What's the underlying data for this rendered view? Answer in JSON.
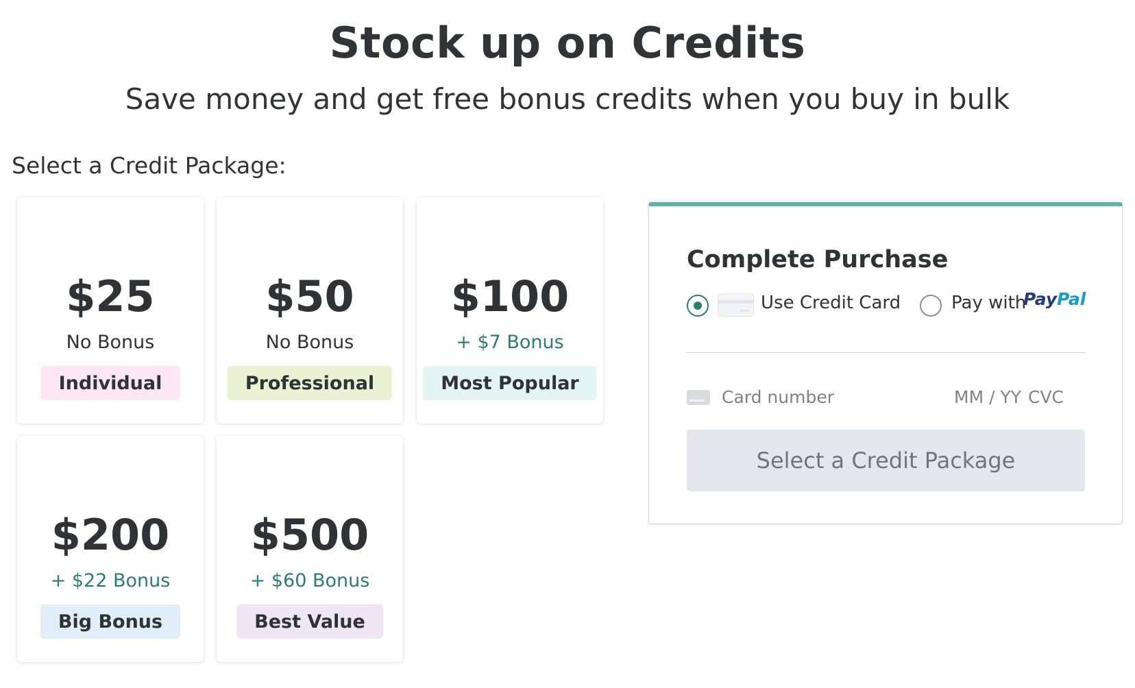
{
  "header": {
    "title": "Stock up on Credits",
    "subtitle": "Save money and get free bonus credits when you buy in bulk"
  },
  "packages_label": "Select a Credit Package:",
  "packages": [
    {
      "price": "$25",
      "bonus": "No Bonus",
      "tag": "Individual",
      "tag_color": "#fbe6f1"
    },
    {
      "price": "$50",
      "bonus": "No Bonus",
      "tag": "Professional",
      "tag_color": "#eaf2d3"
    },
    {
      "price": "$100",
      "bonus": "+ $7 Bonus",
      "tag": "Most Popular",
      "tag_color": "#e3f4f3"
    },
    {
      "price": "$200",
      "bonus": "+ $22 Bonus",
      "tag": "Big Bonus",
      "tag_color": "#e1edf8"
    },
    {
      "price": "$500",
      "bonus": "+ $60 Bonus",
      "tag": "Best Value",
      "tag_color": "#efe6f5"
    }
  ],
  "purchase": {
    "title": "Complete Purchase",
    "accent_color": "#5bb1a4",
    "credit_card_label": "Use Credit Card",
    "paypal_prefix": "Pay with",
    "paypal_brand_pay": "Pay",
    "paypal_brand_pal": "Pal",
    "selected_method": "credit-card",
    "card_number_placeholder": "Card number",
    "expiry_placeholder": "MM / YY",
    "cvc_placeholder": "CVC",
    "submit_label": "Select a Credit Package"
  }
}
